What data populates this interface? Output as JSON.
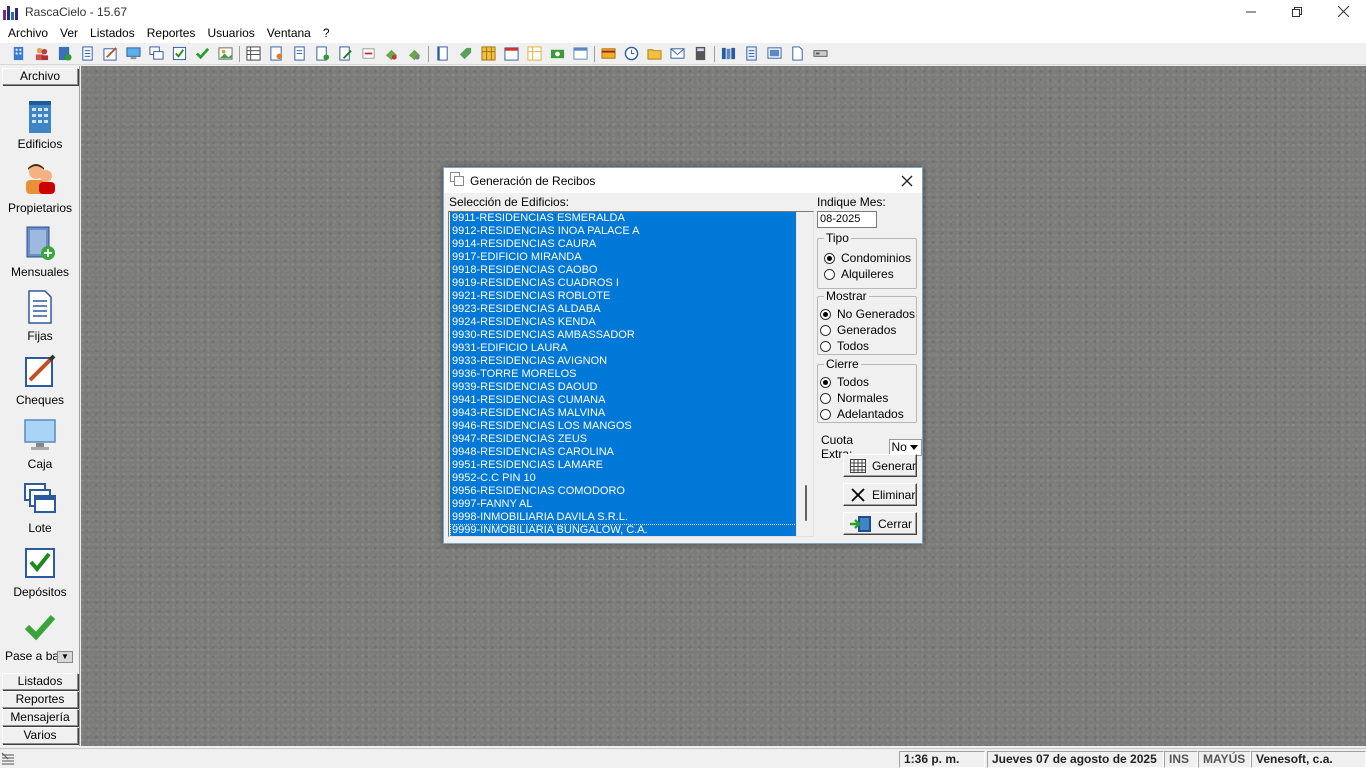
{
  "window": {
    "title": "RascaCielo - 15.67"
  },
  "menu": [
    "Archivo",
    "Ver",
    "Listados",
    "Reportes",
    "Usuarios",
    "Ventana",
    "?"
  ],
  "sidebar": {
    "header": "Archivo",
    "items": [
      {
        "label": "Edificios",
        "icon": "building-icon"
      },
      {
        "label": "Propietarios",
        "icon": "people-icon"
      },
      {
        "label": "Mensuales",
        "icon": "monthly-doc-icon"
      },
      {
        "label": "Fijas",
        "icon": "document-icon"
      },
      {
        "label": "Cheques",
        "icon": "check-edit-icon"
      },
      {
        "label": "Caja",
        "icon": "monitor-icon"
      },
      {
        "label": "Lote",
        "icon": "windows-stack-icon"
      },
      {
        "label": "Depósitos",
        "icon": "checkbox-icon"
      },
      {
        "label": "Pase a bar",
        "icon": "checkmark-icon"
      }
    ],
    "sections": [
      "Listados",
      "Reportes",
      "Mensajería",
      "Varios"
    ]
  },
  "dialog": {
    "title": "Generación de Recibos",
    "list_label": "Selección de Edificios:",
    "buildings": [
      "9911-RESIDENCIAS ESMERALDA",
      "9912-RESIDENCIAS INOA PALACE A",
      "9914-RESIDENCIAS CAURA",
      "9917-EDIFICIO MIRANDA",
      "9918-RESIDENCIAS CAOBO",
      "9919-RESIDENCIAS CUADROS I",
      "9921-RESIDENCIAS ROBLOTE",
      "9923-RESIDENCIAS ALDABA",
      "9924-RESIDENCIAS KENDA",
      "9930-RESIDENCIAS AMBASSADOR",
      "9931-EDIFICIO LAURA",
      "9933-RESIDENCIAS AVIGNON",
      "9936-TORRE MORELOS",
      "9939-RESIDENCIAS DAOUD",
      "9941-RESIDENCIAS CUMANA",
      "9943-RESIDENCIAS MALVINA",
      "9946-RESIDENCIAS LOS MANGOS",
      "9947-RESIDENCIAS ZEUS",
      "9948-RESIDENCIAS CAROLINA",
      "9951-RESIDENCIAS LAMARE",
      "9952-C.C PIN 10",
      "9956-RESIDENCIAS COMODORO",
      "9997-FANNY AL",
      "9998-INMOBILIARIA DAVILA S.R.L.",
      "9999-INMOBILIARIA BUNGALOW, C.A."
    ],
    "month_label": "Indique Mes:",
    "month_value": "08-2025",
    "tipo": {
      "title": "Tipo",
      "options": [
        "Condominios",
        "Alquileres"
      ],
      "selected": "Condominios"
    },
    "mostrar": {
      "title": "Mostrar",
      "options": [
        "No Generados",
        "Generados",
        "Todos"
      ],
      "selected": "No Generados"
    },
    "cierre": {
      "title": "Cierre",
      "options": [
        "Todos",
        "Normales",
        "Adelantados"
      ],
      "selected": "Todos"
    },
    "cuota_label": "Cuota Extra:",
    "cuota_value": "No",
    "buttons": {
      "generar": "Generar",
      "eliminar": "Eliminar",
      "cerrar": "Cerrar"
    }
  },
  "status": {
    "time": "1:36 p. m.",
    "date": "Jueves 07 de agosto de 2025",
    "ins": "INS",
    "caps": "MAYÚS",
    "company": "Venesoft, c.a."
  },
  "colors": {
    "selection": "#0078d7",
    "desktop": "#7b7b79"
  }
}
